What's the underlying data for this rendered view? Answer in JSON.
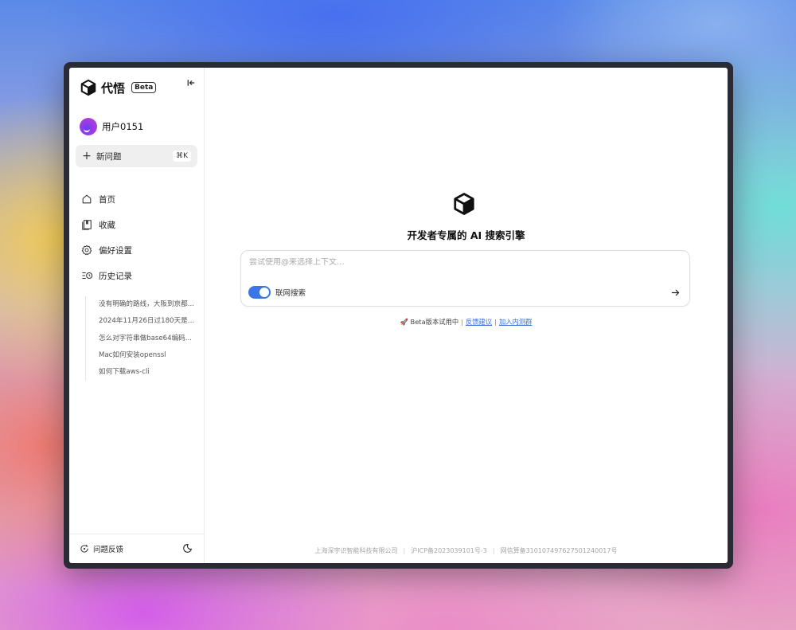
{
  "brand": {
    "name": "代悟",
    "badge": "Beta"
  },
  "user": {
    "name": "用户0151"
  },
  "new_question": {
    "label": "新问题",
    "shortcut": "⌘K"
  },
  "nav": {
    "items": [
      {
        "label": "首页",
        "icon": "home-icon"
      },
      {
        "label": "收藏",
        "icon": "bookmark-icon"
      },
      {
        "label": "偏好设置",
        "icon": "gear-icon"
      },
      {
        "label": "历史记录",
        "icon": "history-icon"
      }
    ]
  },
  "history": [
    "没有明确的路线，大阪到京都...",
    "2024年11月26日过180天是几...",
    "怎么对字符串做base64编码...",
    "Mac如何安装openssl",
    "如何下载aws-cli"
  ],
  "footer": {
    "feedback_label": "问题反馈",
    "theme_icon": "theme-toggle-icon"
  },
  "main": {
    "title": "开发者专属的 AI 搜索引擎",
    "search_placeholder": "尝试使用@来选择上下文...",
    "search_value": "",
    "web_search_label": "联网搜索",
    "web_search_enabled": true,
    "beta_note": "🚀 Beta版本试用中",
    "feedback_link": "反馈建议",
    "join_link": "加入内测群",
    "legal": {
      "company": "上海深宇识智能科技有限公司",
      "icp": "沪ICP备2023039101号-3",
      "algo": "网信算备310107497627501240017号"
    }
  },
  "colors": {
    "accent": "#3a76e6",
    "link": "#3a6fd8",
    "window_frame": "#2b2b36"
  }
}
